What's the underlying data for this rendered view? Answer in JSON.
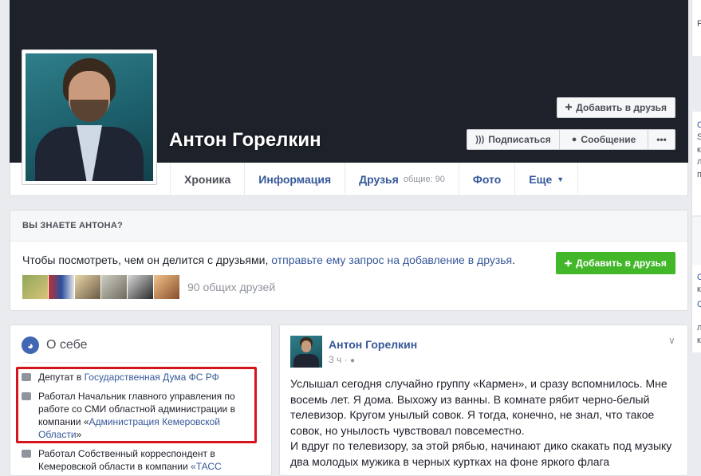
{
  "profile": {
    "name": "Антон Горелкин",
    "add_friend_label": "Добавить в друзья",
    "subscribe_label": "Подписаться",
    "message_label": "Сообщение",
    "more_label": "•••"
  },
  "tabs": [
    {
      "label": "Хроника",
      "active": true
    },
    {
      "label": "Информация"
    },
    {
      "label": "Друзья",
      "sub": "общие: 90"
    },
    {
      "label": "Фото"
    },
    {
      "label": "Еще"
    }
  ],
  "know": {
    "title": "ВЫ ЗНАЕТЕ АНТОНА?",
    "text": "Чтобы посмотреть, чем он делится с друзьями, ",
    "link": "отправьте ему запрос на добавление в друзья",
    "text_end": ".",
    "add_button": "Добавить в друзья",
    "mutual": "90 общих друзей"
  },
  "about": {
    "title": "О себе",
    "items": [
      {
        "prefix": "Депутат в ",
        "link": "Государственная Дума ФС РФ",
        "suffix": ""
      },
      {
        "prefix": "Работал Начальник главного управления по работе со СМИ областной администрации в компании «",
        "link": "Администрация Кемеровской Области",
        "suffix": "»"
      },
      {
        "prefix": "Работал Собственный корреспондент в Кемеровской области в компании ",
        "link": "«ТАСС",
        "suffix": ""
      }
    ]
  },
  "post": {
    "author": "Антон Горелкин",
    "time": "3 ч · ",
    "text_lines": [
      "Услышал сегодня случайно группу «Кармен», и сразу вспомнилось. Мне восемь лет. Я дома. Выхожу из ванны. В комнате рябит черно-белый телевизор. Кругом унылый совок. Я тогда, конечно, не знал, что такое совок, но унылость чувствовал повсеместно.",
      "И вдруг по телевизору, за этой рябью, начинают дико скакать под музыку два молодых мужика в черных куртках на фоне яркого флага"
    ]
  },
  "right_glyphs": [
    "Р",
    "С",
    "S",
    "к",
    "л",
    "п",
    "С",
    "к",
    "С",
    "л",
    "к"
  ],
  "colors": {
    "link": "#365899",
    "green": "#42b72a",
    "red_highlight": "#d6141b",
    "cover": "#1d2129"
  }
}
